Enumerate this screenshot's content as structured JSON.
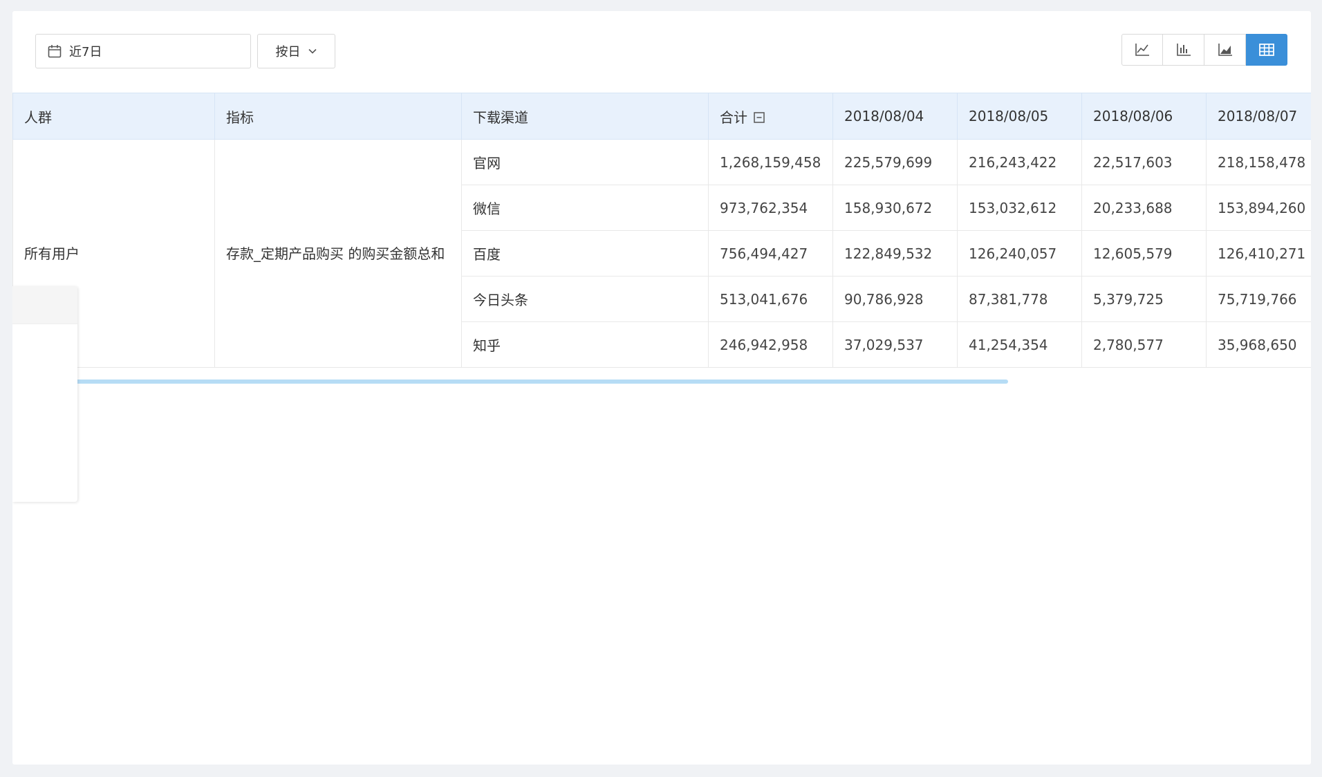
{
  "toolbar": {
    "date_range_label": "近7日",
    "granularity_label": "按日",
    "view_modes": [
      {
        "name": "line-chart",
        "active": false
      },
      {
        "name": "bar-chart",
        "active": false
      },
      {
        "name": "area-chart",
        "active": false
      },
      {
        "name": "table",
        "active": true
      }
    ]
  },
  "table": {
    "headers": {
      "crowd": "人群",
      "metric": "指标",
      "channel": "下载渠道",
      "total": "合计",
      "dates": [
        "2018/08/04",
        "2018/08/05",
        "2018/08/06",
        "2018/08/07"
      ]
    },
    "group": {
      "crowd": "所有用户",
      "metric": "存款_定期产品购买 的购买金额总和"
    },
    "rows": [
      {
        "channel": "官网",
        "total": "1,268,159,458",
        "values": [
          "225,579,699",
          "216,243,422",
          "22,517,603",
          "218,158,478"
        ]
      },
      {
        "channel": "微信",
        "total": "973,762,354",
        "values": [
          "158,930,672",
          "153,032,612",
          "20,233,688",
          "153,894,260"
        ]
      },
      {
        "channel": "百度",
        "total": "756,494,427",
        "values": [
          "122,849,532",
          "126,240,057",
          "12,605,579",
          "126,410,271"
        ]
      },
      {
        "channel": "今日头条",
        "total": "513,041,676",
        "values": [
          "90,786,928",
          "87,381,778",
          "5,379,725",
          "75,719,766"
        ]
      },
      {
        "channel": "知乎",
        "total": "246,942,958",
        "values": [
          "37,029,537",
          "41,254,354",
          "2,780,577",
          "35,968,650"
        ]
      }
    ]
  },
  "colors": {
    "accent": "#3a8fd9",
    "header_bg": "#e8f1fc",
    "scrollbar": "#b6dcf5"
  }
}
